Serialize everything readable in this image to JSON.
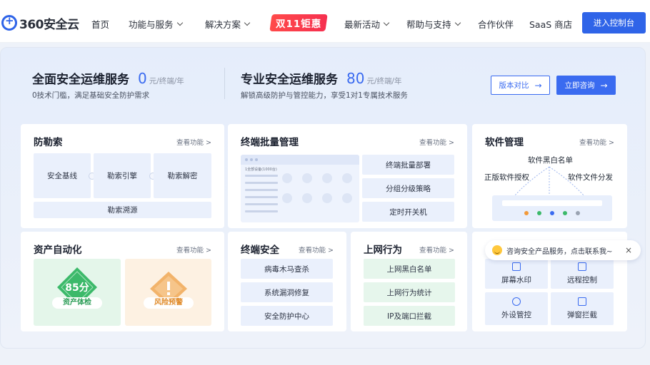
{
  "nav": {
    "logo": "360安全云",
    "items": [
      {
        "label": "首页",
        "dropdown": false
      },
      {
        "label": "功能与服务",
        "dropdown": true
      },
      {
        "label": "解决方案",
        "dropdown": true
      },
      {
        "label": "最新活动",
        "dropdown": true
      },
      {
        "label": "帮助与支持",
        "dropdown": true
      },
      {
        "label": "合作伙伴",
        "dropdown": false
      },
      {
        "label": "SaaS 商店",
        "dropdown": false
      }
    ],
    "promo": "双11钜惠",
    "console_button": "进入控制台"
  },
  "hero": {
    "left": {
      "title": "全面安全运维服务",
      "price": "0",
      "unit": "元/终端/年",
      "desc": "0技术门槛，满足基础安全防护需求"
    },
    "right": {
      "title": "专业安全运维服务",
      "price": "80",
      "unit": "元/终端/年",
      "desc": "解锁高级防护与管控能力，享受1对1专属技术服务"
    },
    "compare_button": "版本对比",
    "consult_button": "立即咨询"
  },
  "link_text": "查看功能 >",
  "cards": {
    "ransom": {
      "title": "防勒索",
      "tiles": [
        "安全基线",
        "勒索引擎",
        "勒索解密"
      ],
      "bottom": "勒索溯源"
    },
    "batch": {
      "title": "终端批量管理",
      "tiles": [
        "终端批量部署",
        "分组分级策略",
        "定时开关机"
      ],
      "mock_caption": "1全部设备(1000台)"
    },
    "software": {
      "title": "软件管理",
      "top": "软件黑白名单",
      "left": "正版软件授权",
      "right": "软件文件分发"
    },
    "asset": {
      "title": "资产自动化",
      "score": "85分",
      "check_label": "资产体检",
      "warn_label": "风险预警"
    },
    "endpoint": {
      "title": "终端安全",
      "tiles": [
        "病毒木马查杀",
        "系统漏洞修复",
        "安全防护中心"
      ]
    },
    "internet": {
      "title": "上网行为",
      "tiles": [
        "上网黑白名单",
        "上网行为统计",
        "IP及端口拦截"
      ]
    },
    "misc": {
      "tiles": [
        "屏幕水印",
        "远程控制",
        "外设管控",
        "弹窗拦截"
      ]
    }
  },
  "chat": {
    "text": "咨询安全产品服务，点击联系我~",
    "close": "×"
  },
  "colors": {
    "primary": "#2f64e8",
    "accent": "#3a6bf0",
    "promo": "#f6304f",
    "green": "#3cb96a",
    "orange": "#f29a3a"
  }
}
